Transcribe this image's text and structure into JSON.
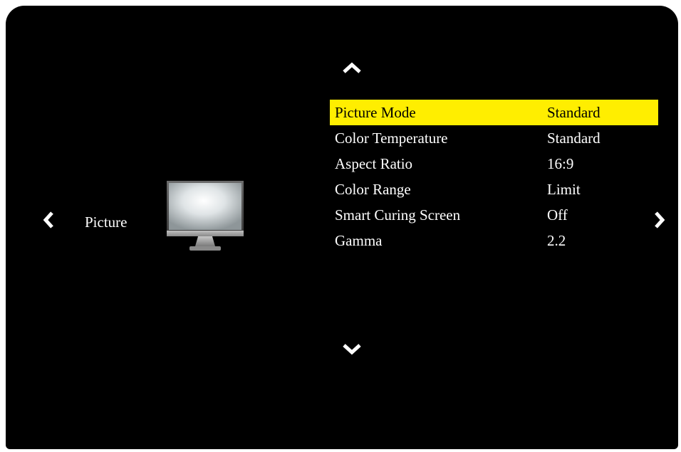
{
  "category": {
    "label": "Picture",
    "icon": "monitor-icon"
  },
  "navigation": {
    "up_icon": "chevron-up-icon",
    "down_icon": "chevron-down-icon",
    "left_icon": "chevron-left-icon",
    "right_icon": "chevron-right-icon"
  },
  "menu": {
    "selected_index": 0,
    "highlight_color": "#ffee00",
    "items": [
      {
        "label": "Picture Mode",
        "value": "Standard"
      },
      {
        "label": "Color Temperature",
        "value": "Standard"
      },
      {
        "label": "Aspect Ratio",
        "value": "16:9"
      },
      {
        "label": "Color Range",
        "value": "Limit"
      },
      {
        "label": "Smart Curing Screen",
        "value": "Off"
      },
      {
        "label": "Gamma",
        "value": "2.2"
      }
    ]
  }
}
